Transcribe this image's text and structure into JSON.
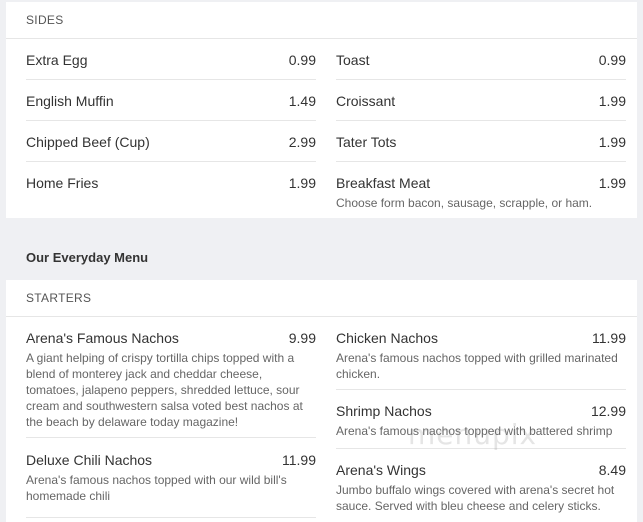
{
  "sides": {
    "heading": "SIDES",
    "left": [
      {
        "name": "Extra Egg",
        "price": "0.99"
      },
      {
        "name": "English Muffin",
        "price": "1.49"
      },
      {
        "name": "Chipped Beef (Cup)",
        "price": "2.99"
      },
      {
        "name": "Home Fries",
        "price": "1.99"
      }
    ],
    "right": [
      {
        "name": "Toast",
        "price": "0.99"
      },
      {
        "name": "Croissant",
        "price": "1.99"
      },
      {
        "name": "Tater Tots",
        "price": "1.99"
      },
      {
        "name": "Breakfast Meat",
        "price": "1.99",
        "desc": "Choose form bacon, sausage, scrapple, or ham."
      }
    ]
  },
  "menu_title": "Our Everyday Menu",
  "starters": {
    "heading": "STARTERS",
    "left": [
      {
        "name": "Arena's Famous Nachos",
        "price": "9.99",
        "desc": "A giant helping of crispy tortilla chips topped with a blend of monterey jack and cheddar cheese, tomatoes, jalapeno peppers, shredded lettuce, sour cream and southwestern salsa voted best nachos at the beach by delaware today magazine!"
      },
      {
        "name": "Deluxe Chili Nachos",
        "price": "11.99",
        "desc": "Arena's famous nachos topped with our wild bill's homemade chili"
      }
    ],
    "right": [
      {
        "name": "Chicken Nachos",
        "price": "11.99",
        "desc": "Arena's famous nachos topped with grilled marinated chicken."
      },
      {
        "name": "Shrimp Nachos",
        "price": "12.99",
        "desc": "Arena's famous nachos topped with battered shrimp"
      },
      {
        "name": "Arena's Wings",
        "price": "8.49",
        "desc": "Jumbo buffalo wings covered with arena's secret hot sauce. Served with bleu cheese and celery sticks."
      }
    ]
  },
  "watermark": "menupix"
}
